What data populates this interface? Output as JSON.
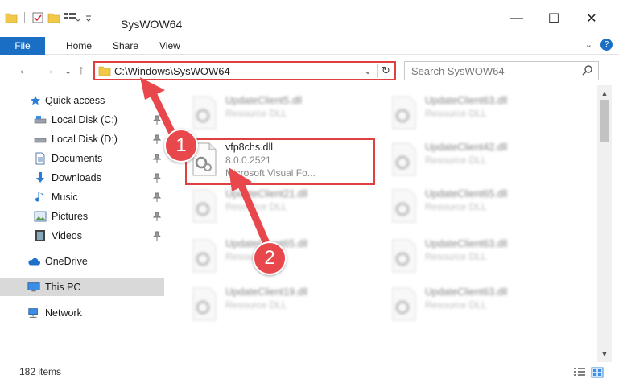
{
  "window": {
    "title": "SysWOW64",
    "controls": {
      "minimize": "—",
      "maximize": "☐",
      "close": "✕"
    }
  },
  "ribbon": {
    "file_label": "File",
    "tabs": [
      "Home",
      "Share",
      "View"
    ],
    "expand": "⌄",
    "help": "?"
  },
  "address": {
    "path": "C:\\Windows\\SysWOW64",
    "dropdown": "⌄",
    "refresh": "↻"
  },
  "search": {
    "placeholder": "Search SysWOW64"
  },
  "nav": {
    "back": "←",
    "forward": "→",
    "recent": "⌄",
    "up": "↑",
    "items": [
      {
        "label": "Quick access",
        "icon": "star-icon"
      },
      {
        "label": "Local Disk (C:)",
        "icon": "drive-icon",
        "pinned": true
      },
      {
        "label": "Local Disk (D:)",
        "icon": "drive-icon",
        "pinned": true
      },
      {
        "label": "Documents",
        "icon": "documents-icon",
        "pinned": true
      },
      {
        "label": "Downloads",
        "icon": "downloads-icon",
        "pinned": true
      },
      {
        "label": "Music",
        "icon": "music-icon",
        "pinned": true
      },
      {
        "label": "Pictures",
        "icon": "pictures-icon",
        "pinned": true
      },
      {
        "label": "Videos",
        "icon": "videos-icon",
        "pinned": true
      },
      {
        "label": "OneDrive",
        "icon": "cloud-icon"
      },
      {
        "label": "This PC",
        "icon": "computer-icon",
        "selected": true
      },
      {
        "label": "Network",
        "icon": "network-icon"
      }
    ]
  },
  "files": {
    "highlighted": {
      "name": "vfp8chs.dll",
      "version": "8.0.0.2521",
      "description": "Microsoft Visual Fo..."
    },
    "others": [
      {
        "name": "UpdateClient5.dll",
        "type": "Resource DLL"
      },
      {
        "name": "UpdateClient63.dll",
        "type": "Resource DLL"
      },
      {
        "name": "UpdateClient42.dll",
        "type": "Resource DLL"
      },
      {
        "name": "UpdateClient21.dll",
        "type": "Resource DLL"
      },
      {
        "name": "UpdateClient65.dll",
        "type": "Resource DLL"
      },
      {
        "name": "UpdateClient65.dll",
        "type": "Resource DLL"
      },
      {
        "name": "UpdateClient63.dll",
        "type": "Resource DLL"
      },
      {
        "name": "UpdateClient19.dll",
        "type": "Resource DLL"
      },
      {
        "name": "UpdateClient63.dll",
        "type": "Resource DLL"
      }
    ]
  },
  "status": {
    "item_count": "182 items"
  },
  "annotations": {
    "step1": "1",
    "step2": "2"
  },
  "colors": {
    "accent": "#1a6fc4",
    "highlight": "#e04040",
    "badge": "#e8474c"
  }
}
